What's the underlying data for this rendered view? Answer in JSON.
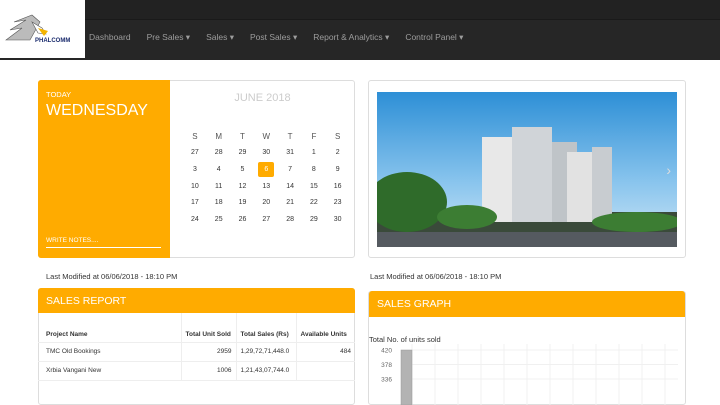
{
  "brand": {
    "name": "PHALCOMM"
  },
  "nav": {
    "items": [
      "Dashboard",
      "Pre Sales ▾",
      "Sales ▾",
      "Post Sales ▾",
      "Report & Analytics ▾",
      "Control Panel ▾"
    ]
  },
  "today": {
    "label": "TODAY",
    "day": "WEDNESDAY",
    "notes": "WRITE NOTES...."
  },
  "calendar": {
    "month": "JUNE 2018",
    "weekdays": [
      "S",
      "M",
      "T",
      "W",
      "T",
      "F",
      "S"
    ],
    "weeks": [
      [
        "27",
        "28",
        "29",
        "30",
        "31",
        "1",
        "2"
      ],
      [
        "3",
        "4",
        "5",
        "6",
        "7",
        "8",
        "9"
      ],
      [
        "10",
        "11",
        "12",
        "13",
        "14",
        "15",
        "16"
      ],
      [
        "17",
        "18",
        "19",
        "20",
        "21",
        "22",
        "23"
      ],
      [
        "24",
        "25",
        "26",
        "27",
        "28",
        "29",
        "30"
      ]
    ],
    "selected": "6"
  },
  "modified_left": "Last Modified at 06/06/2018 - 18:10 PM",
  "modified_right": "Last Modified at 06/06/2018 - 18:10 PM",
  "sales_report": {
    "title": "SALES REPORT",
    "columns": [
      "Project Name",
      "Total Unit Sold",
      "Total Sales (Rs)",
      "Available Units"
    ],
    "rows": [
      [
        "TMC Old Bookings",
        "2959",
        "1,29,72,71,448.0",
        "484"
      ],
      [
        "Xrbia Vangani New",
        "1006",
        "1,21,43,07,744.0",
        ""
      ]
    ]
  },
  "sales_graph": {
    "title": "SALES GRAPH"
  },
  "chart_data": {
    "type": "bar",
    "title": "Total No. of units sold",
    "yticks": [
      420,
      378,
      336
    ],
    "values": [
      420
    ]
  },
  "colors": {
    "accent": "#ffab00",
    "nav": "#262626"
  }
}
